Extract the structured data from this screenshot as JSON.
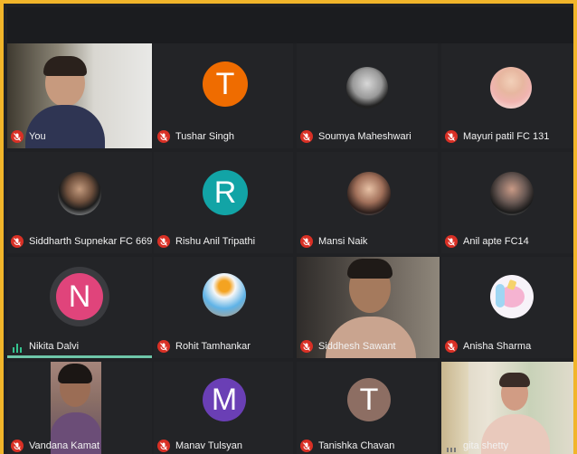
{
  "colors": {
    "accent_border": "#f1b52a",
    "muted_mic": "#d93025",
    "active_mic": "#34c38f"
  },
  "participants": [
    {
      "name": "You",
      "avatar": "photo",
      "muted": true
    },
    {
      "name": "Tushar Singh",
      "initial": "T",
      "avatar_color": "#ef6c00",
      "muted": true
    },
    {
      "name": "Soumya Maheshwari",
      "avatar": "photo",
      "muted": true
    },
    {
      "name": "Mayuri patil FC 131",
      "avatar": "photo",
      "muted": true
    },
    {
      "name": "Siddharth Supnekar FC 669",
      "avatar": "photo",
      "muted": true
    },
    {
      "name": "Rishu Anil Tripathi",
      "initial": "R",
      "avatar_color": "#12a4a6",
      "muted": true
    },
    {
      "name": "Mansi Naik",
      "avatar": "photo",
      "muted": true
    },
    {
      "name": "Anil apte FC14",
      "avatar": "photo",
      "muted": true
    },
    {
      "name": "Nikita Dalvi",
      "initial": "N",
      "avatar_color": "#e0447b",
      "muted": false,
      "speaking": true
    },
    {
      "name": "Rohit Tamhankar",
      "avatar": "photo",
      "muted": true
    },
    {
      "name": "Siddhesh Sawant",
      "avatar": "video",
      "muted": true
    },
    {
      "name": "Anisha Sharma",
      "avatar": "photo",
      "muted": true
    },
    {
      "name": "Vandana Kamat",
      "avatar": "video",
      "muted": true
    },
    {
      "name": "Manav Tulsyan",
      "initial": "M",
      "avatar_color": "#6a3fb5",
      "muted": true
    },
    {
      "name": "Tanishka Chavan",
      "initial": "T",
      "avatar_color": "#8d6e63",
      "muted": true
    },
    {
      "name": "gita shetty",
      "avatar": "video",
      "muted": false
    }
  ]
}
